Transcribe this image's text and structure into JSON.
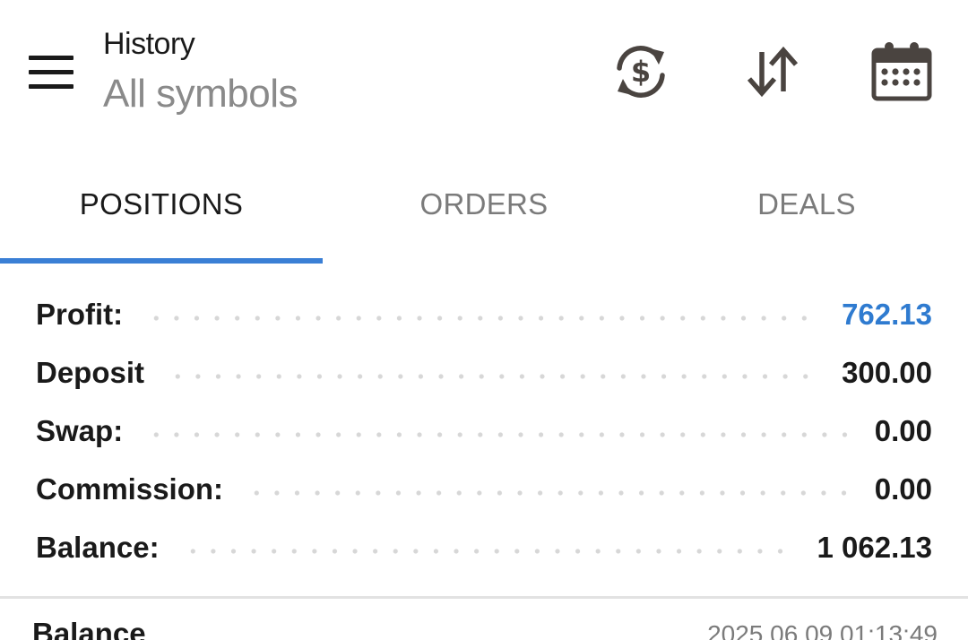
{
  "header": {
    "title": "History",
    "subtitle": "All symbols",
    "icons": [
      "menu-icon",
      "currency-exchange-icon",
      "sort-icon",
      "calendar-icon"
    ]
  },
  "tabs": [
    {
      "label": "POSITIONS",
      "active": true
    },
    {
      "label": "ORDERS",
      "active": false
    },
    {
      "label": "DEALS",
      "active": false
    }
  ],
  "summary": {
    "rows": [
      {
        "label": "Profit:",
        "value": "762.13",
        "highlight": true
      },
      {
        "label": "Deposit",
        "value": "300.00",
        "highlight": false
      },
      {
        "label": "Swap:",
        "value": "0.00",
        "highlight": false
      },
      {
        "label": "Commission:",
        "value": "0.00",
        "highlight": false
      },
      {
        "label": "Balance:",
        "value": "1 062.13",
        "highlight": false
      }
    ]
  },
  "list": {
    "items": [
      {
        "type": "Balance",
        "time": "2025.06.09 01:13:49"
      }
    ]
  },
  "colors": {
    "accent": "#3a7fd5",
    "profit": "#2f7bd0",
    "icon": "#4a4440"
  }
}
